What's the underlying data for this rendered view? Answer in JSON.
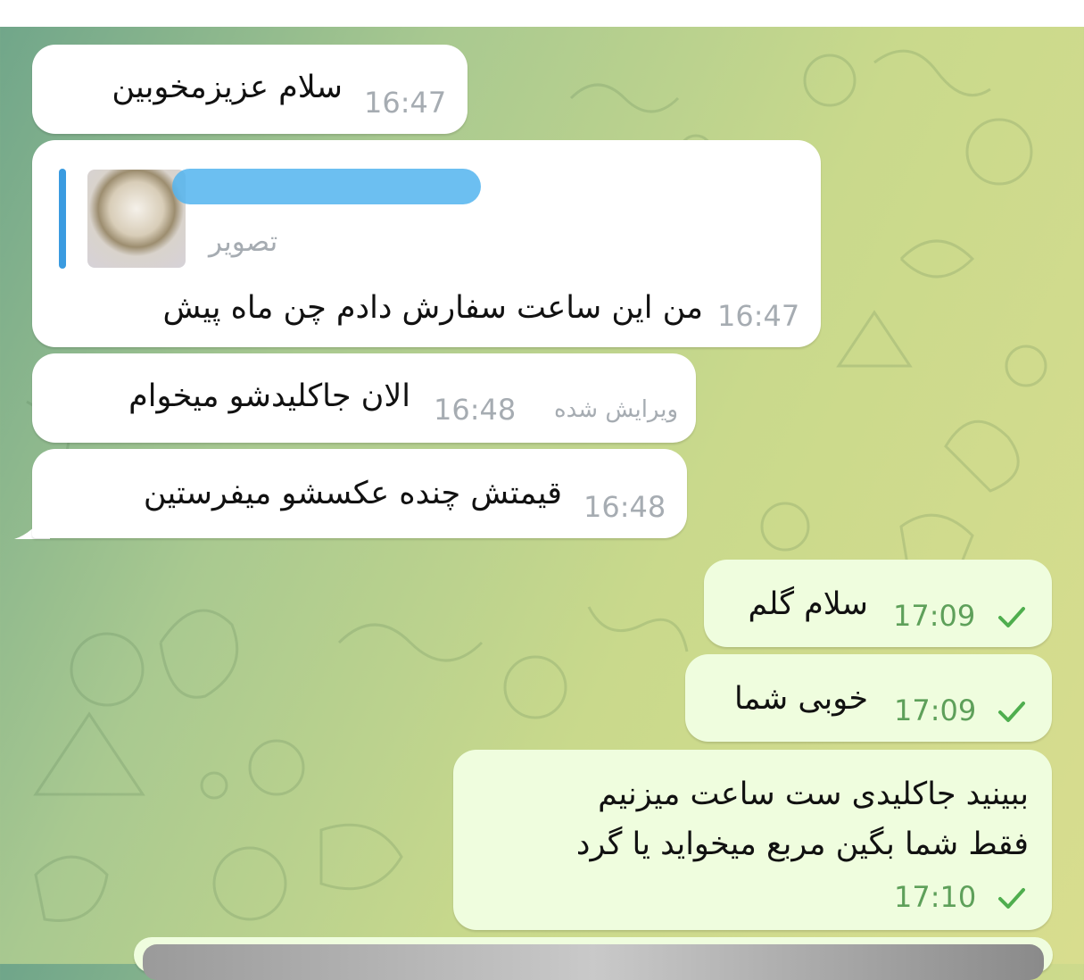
{
  "messages": [
    {
      "id": "m1",
      "direction": "incoming",
      "text": "سلام عزیزمخوبین",
      "time": "16:47"
    },
    {
      "id": "m2",
      "direction": "incoming",
      "reply": {
        "subtitle": "تصویر"
      },
      "text": "من این ساعت سفارش دادم چن ماه پیش",
      "time": "16:47"
    },
    {
      "id": "m3",
      "direction": "incoming",
      "text": "الان جاکلیدشو میخوام",
      "edited": "ویرایش شده",
      "time": "16:48"
    },
    {
      "id": "m4",
      "direction": "incoming",
      "text": "قیمتش چنده عکسشو میفرستین",
      "time": "16:48"
    },
    {
      "id": "m5",
      "direction": "outgoing",
      "text": "سلام گلم",
      "time": "17:09",
      "status": "sent-check"
    },
    {
      "id": "m6",
      "direction": "outgoing",
      "text": "خوبی شما",
      "time": "17:09",
      "status": "sent-check"
    },
    {
      "id": "m7",
      "direction": "outgoing",
      "lines": [
        "ببینید جاکلیدی ست ساعت میزنیم",
        "فقط شما بگین مربع میخواید یا گرد"
      ],
      "time": "17:10",
      "status": "sent-check"
    }
  ],
  "colors": {
    "incoming_bubble": "#ffffff",
    "outgoing_bubble": "#effdde",
    "time_incoming": "#a6acb2",
    "time_outgoing": "#5ea05a",
    "check": "#4fae4e",
    "reply_accent": "#3a9be0",
    "redaction": "#52b4ef"
  }
}
